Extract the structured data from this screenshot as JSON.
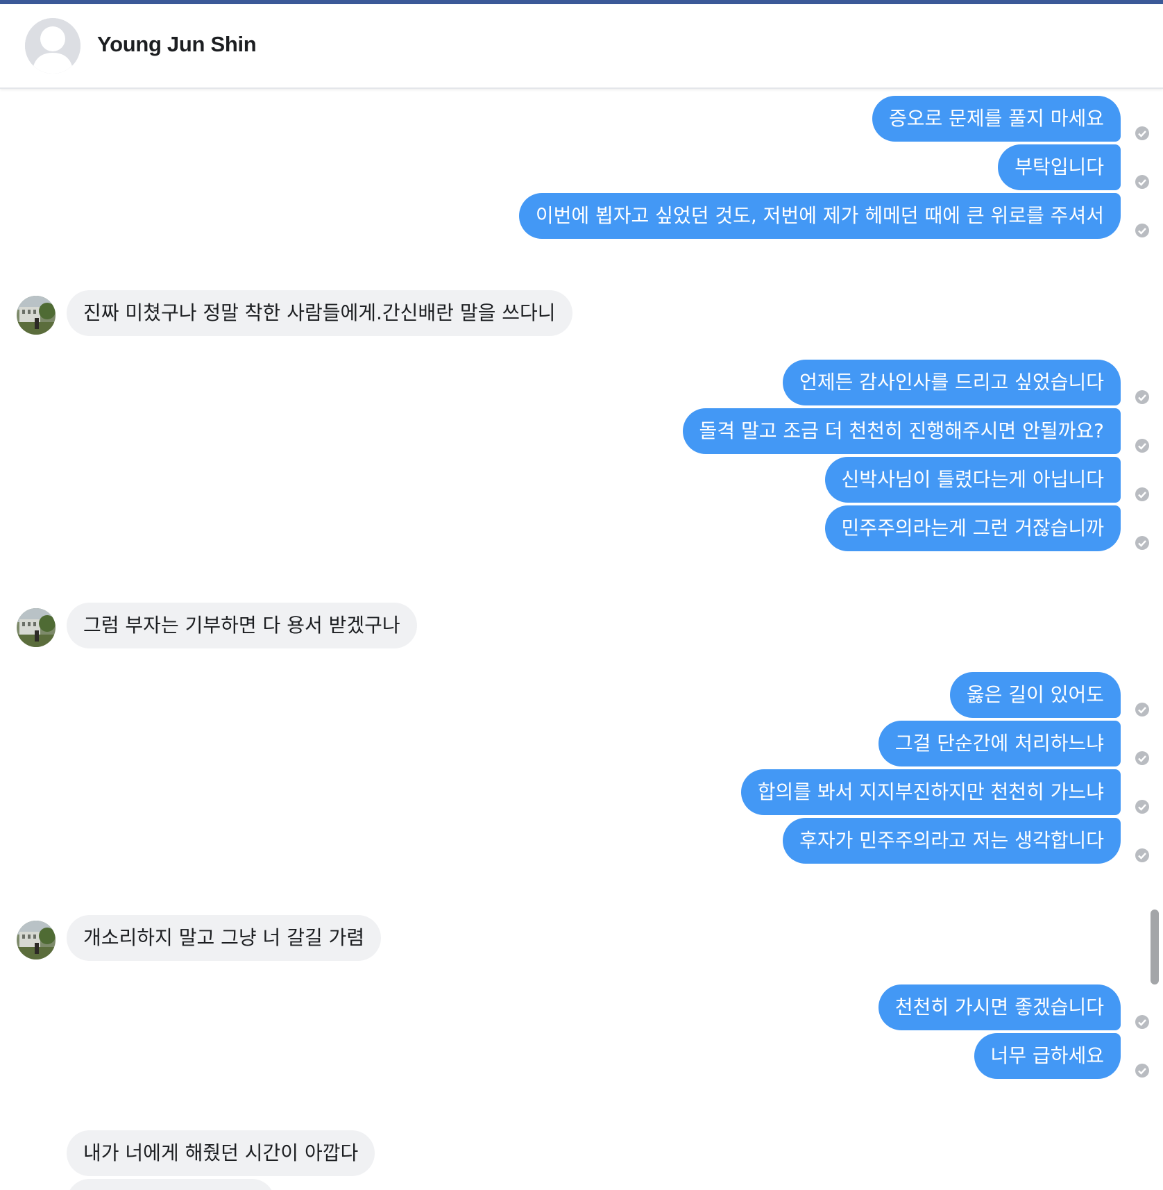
{
  "header": {
    "contact_name": "Young Jun Shin"
  },
  "messages": [
    {
      "dir": "out",
      "text": "증오로 문제를 풀지 마세요"
    },
    {
      "dir": "out",
      "text": "부탁입니다"
    },
    {
      "dir": "out",
      "text": "이번에 뵙자고 싶었던 것도, 저번에 제가 헤메던 때에 큰 위로를 주셔서"
    },
    {
      "dir": "in",
      "text": "진짜 미쳤구나 정말 착한 사람들에게.간신배란 말을 쓰다니"
    },
    {
      "dir": "out",
      "text": "언제든 감사인사를 드리고 싶었습니다"
    },
    {
      "dir": "out",
      "text": "돌격 말고 조금 더 천천히 진행해주시면 안될까요?"
    },
    {
      "dir": "out",
      "text": "신박사님이 틀렸다는게 아닙니다"
    },
    {
      "dir": "out",
      "text": "민주주의라는게 그런 거잖습니까"
    },
    {
      "dir": "in",
      "text": "그럼 부자는 기부하면 다 용서 받겠구나"
    },
    {
      "dir": "out",
      "text": "옳은 길이 있어도"
    },
    {
      "dir": "out",
      "text": "그걸 단순간에 처리하느냐"
    },
    {
      "dir": "out",
      "text": "합의를 봐서 지지부진하지만 천천히 가느냐"
    },
    {
      "dir": "out",
      "text": "후자가 민주주의라고 저는 생각합니다"
    },
    {
      "dir": "in",
      "text": "개소리하지 말고 그냥 너 갈길 가렴"
    },
    {
      "dir": "out",
      "text": "천천히 가시면 좋겠습니다"
    },
    {
      "dir": "out",
      "text": "너무 급하세요"
    },
    {
      "dir": "in",
      "text": "내가 너에게 해줬던 시간이 아깝다"
    }
  ],
  "colors": {
    "outgoing_bubble": "#4398f5",
    "incoming_bubble": "#f0f1f3",
    "top_accent": "#3b5998"
  }
}
